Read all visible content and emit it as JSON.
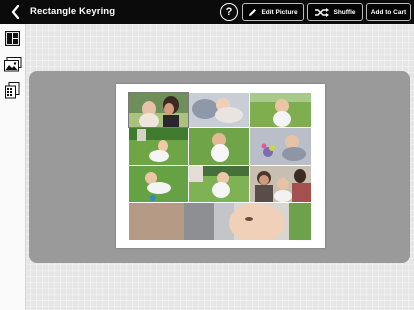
{
  "header": {
    "title": "Rectangle Keyring",
    "help_label": "?",
    "edit_label": "Edit Picture",
    "shuffle_label": "Shuffle",
    "cart_label": "Add to Cart"
  },
  "sidebar": {
    "items": [
      {
        "icon": "layout-icon"
      },
      {
        "icon": "photos-icon"
      },
      {
        "icon": "stickers-icon"
      }
    ]
  },
  "collage": {
    "photos": [
      {
        "name": "photo-mother-baby",
        "scene": "family"
      },
      {
        "name": "photo-baby-sleeping",
        "scene": "sleeping"
      },
      {
        "name": "photo-baby-grass",
        "scene": "grass"
      },
      {
        "name": "photo-toddler-lawn",
        "scene": "lawn"
      },
      {
        "name": "photo-child-sitting-grass",
        "scene": "grass"
      },
      {
        "name": "photo-baby-toys",
        "scene": "toys"
      },
      {
        "name": "photo-baby-crawling",
        "scene": "grass"
      },
      {
        "name": "photo-toddler-yard",
        "scene": "grass"
      },
      {
        "name": "photo-family-group",
        "scene": "family"
      },
      {
        "name": "photo-baby-closeup",
        "scene": "sleeping"
      }
    ]
  }
}
